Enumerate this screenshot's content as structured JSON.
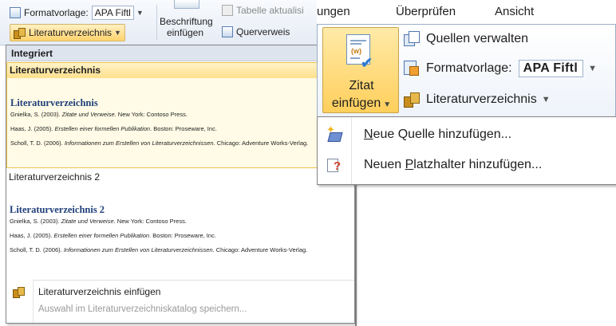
{
  "left_ribbon": {
    "formatvorlage_label": "Formatvorlage:",
    "formatvorlage_value": "APA Fiftl",
    "literaturverzeichnis_label": "Literaturverzeichnis",
    "beschriftung_line1": "Beschriftung",
    "beschriftung_line2": "einfügen",
    "tabelle_label": "Tabelle aktualisi",
    "querverweis_label": "Querverweis"
  },
  "gallery": {
    "section_header": "Integriert",
    "items": [
      {
        "label": "Literaturverzeichnis",
        "preview_title": "Literaturverzeichnis",
        "entries": [
          {
            "pre": "Gnielka, S. (2003). ",
            "italic": "Zitate und Verweise",
            "post": ". New York: Contoso Press."
          },
          {
            "pre": "Haas, J. (2005). ",
            "italic": "Erstellen einer formellen Publikation",
            "post": ". Boston: Proseware, Inc."
          },
          {
            "pre": "Scholl, T. D. (2006). ",
            "italic": "Informationen zum Erstellen von Literaturverzeichnissen",
            "post": ". Chicago: Adventure Works-Verlag."
          }
        ]
      },
      {
        "label": "Literaturverzeichnis 2",
        "preview_title": "Literaturverzeichnis 2",
        "entries": [
          {
            "pre": "Gnielka, S. (2003). ",
            "italic": "Zitate und Verweise",
            "post": ". New York: Contoso Press."
          },
          {
            "pre": "Haas, J. (2005). ",
            "italic": "Erstellen einer formellen Publikation",
            "post": ". Boston: Proseware, Inc."
          },
          {
            "pre": "Scholl, T. D. (2006). ",
            "italic": "Informationen zum Erstellen von Literaturverzeichnissen",
            "post": ". Chicago: Adventure Works-Verlag."
          }
        ]
      }
    ],
    "insert_command": "Literaturverzeichnis einfügen",
    "save_command": "Auswahl im Literaturverzeichniskatalog speichern..."
  },
  "right_tabs": [
    "ungen",
    "Überprüfen",
    "Ansicht"
  ],
  "zitat_panel": {
    "zitat_line1": "Zitat",
    "zitat_line2": "einfügen",
    "quellen_label": "Quellen verwalten",
    "formatvorlage_label": "Formatvorlage:",
    "formatvorlage_value": "APA Fiftl",
    "literaturverzeichnis_label": "Literaturverzeichnis"
  },
  "zitat_menu": {
    "neue_quelle": "Neue Quelle hinzufügen...",
    "neuer_platzhalter": "Neuen Platzhalter hinzufügen..."
  },
  "colors": {
    "hover_gold": "#ffd36b",
    "ribbon_blue": "#e6ecf5",
    "preview_title_blue": "#1f3f7a"
  }
}
